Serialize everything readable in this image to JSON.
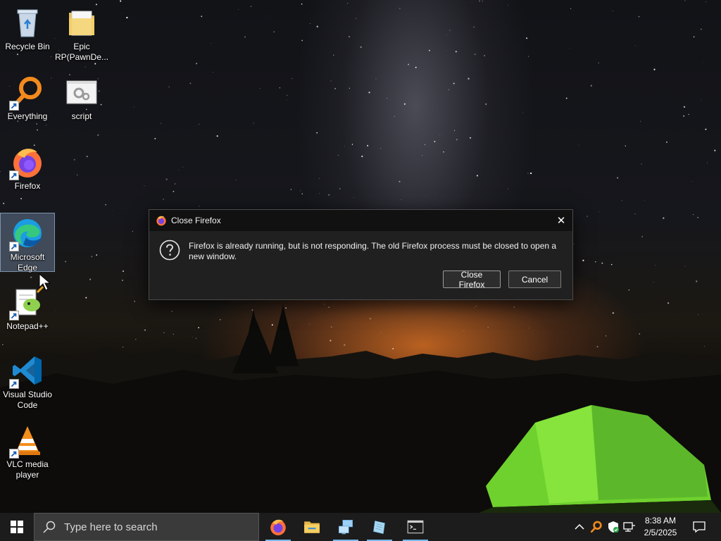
{
  "desktop": {
    "icons": [
      {
        "label": "Recycle Bin",
        "icon": "recycle-bin-icon"
      },
      {
        "label": "Epic RP(PawnDe...",
        "icon": "folder-icon"
      },
      {
        "label": "Everything",
        "icon": "everything-search-icon"
      },
      {
        "label": "script",
        "icon": "script-file-icon"
      },
      {
        "label": "Firefox",
        "icon": "firefox-icon"
      },
      {
        "label": "Microsoft Edge",
        "icon": "edge-icon"
      },
      {
        "label": "Notepad++",
        "icon": "notepadpp-icon"
      },
      {
        "label": "Visual Studio Code",
        "icon": "vscode-icon"
      },
      {
        "label": "VLC media player",
        "icon": "vlc-icon"
      }
    ]
  },
  "dialog": {
    "title": "Close Firefox",
    "message": "Firefox is already running, but is not responding. The old Firefox process must be closed to open a new window.",
    "close_firefox_label": "Close Firefox",
    "cancel_label": "Cancel",
    "close_glyph": "✕"
  },
  "taskbar": {
    "search_placeholder": "Type here to search",
    "apps": [
      "firefox-icon",
      "file-explorer-icon",
      "network-icon",
      "notepad-icon",
      "terminal-icon"
    ],
    "clock": {
      "time": "8:38 AM",
      "date": "2/5/2025"
    },
    "accent_color": "#76b9ed"
  }
}
